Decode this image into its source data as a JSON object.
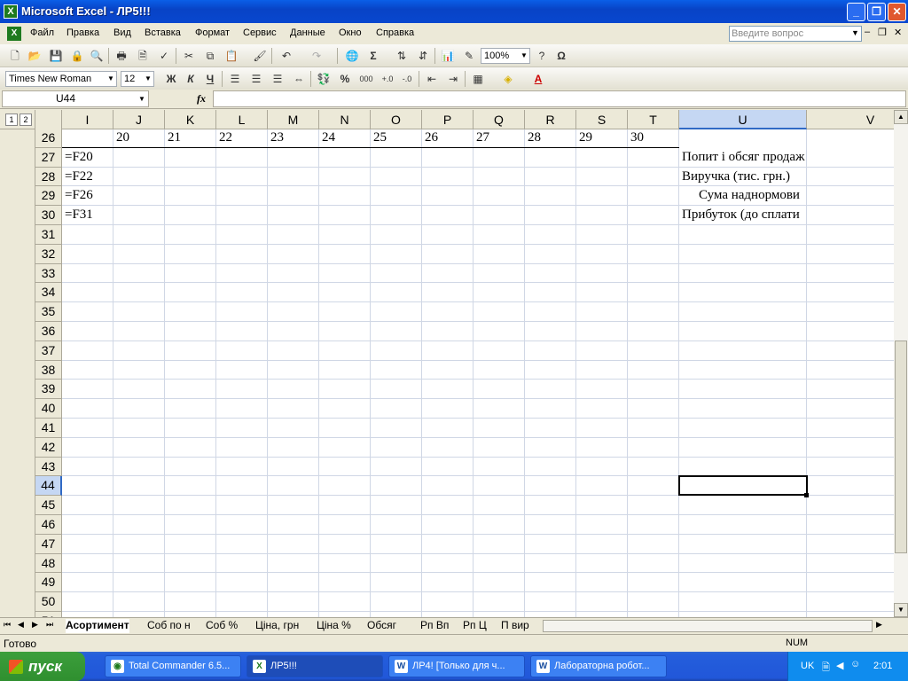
{
  "window": {
    "title": "Microsoft Excel - ЛР5!!!"
  },
  "menu": [
    "Файл",
    "Правка",
    "Вид",
    "Вставка",
    "Формат",
    "Сервис",
    "Данные",
    "Окно",
    "Справка"
  ],
  "ask_placeholder": "Введите вопрос",
  "toolbar": {
    "zoom": "100%",
    "font": "Times New Roman",
    "size": "12",
    "bold": "Ж",
    "italic": "К",
    "underline": "Ч"
  },
  "formula": {
    "name_box": "U44",
    "fx": "fx",
    "value": ""
  },
  "outline_levels": [
    "1",
    "2"
  ],
  "columns": [
    "I",
    "J",
    "K",
    "L",
    "M",
    "N",
    "O",
    "P",
    "Q",
    "R",
    "S",
    "T",
    "U",
    "V"
  ],
  "rows": [
    "26",
    "27",
    "28",
    "29",
    "30",
    "31",
    "32",
    "33",
    "34",
    "35",
    "36",
    "37",
    "38",
    "39",
    "40",
    "41",
    "42",
    "43",
    "44",
    "45",
    "46",
    "47",
    "48",
    "49",
    "50",
    "51"
  ],
  "cells": {
    "row26": [
      "20",
      "21",
      "22",
      "23",
      "24",
      "25",
      "26",
      "27",
      "28",
      "29",
      "30"
    ],
    "I27": "=F20",
    "I28": "=F22",
    "I29": "=F26",
    "I30": "=F31",
    "U27": "Попит і обсяг продаж",
    "U28": "Виручка (тис. грн.)",
    "U29": "Сума наднормови",
    "U30": "Прибуток (до сплати"
  },
  "sheets": [
    "Асортимент",
    "Соб по н",
    "Соб %",
    "Ціна, грн",
    "Ціна %",
    "Обсяг",
    "Рп Вп",
    "Рп Ц",
    "П вир"
  ],
  "status": {
    "left": "Готово",
    "num": "NUM"
  },
  "taskbar": {
    "start": "пуск",
    "tasks": [
      "Total Commander 6.5...",
      "ЛР5!!!",
      "ЛР4! [Только для ч...",
      "Лабораторна робот..."
    ],
    "lang": "UK",
    "clock": "2:01"
  }
}
